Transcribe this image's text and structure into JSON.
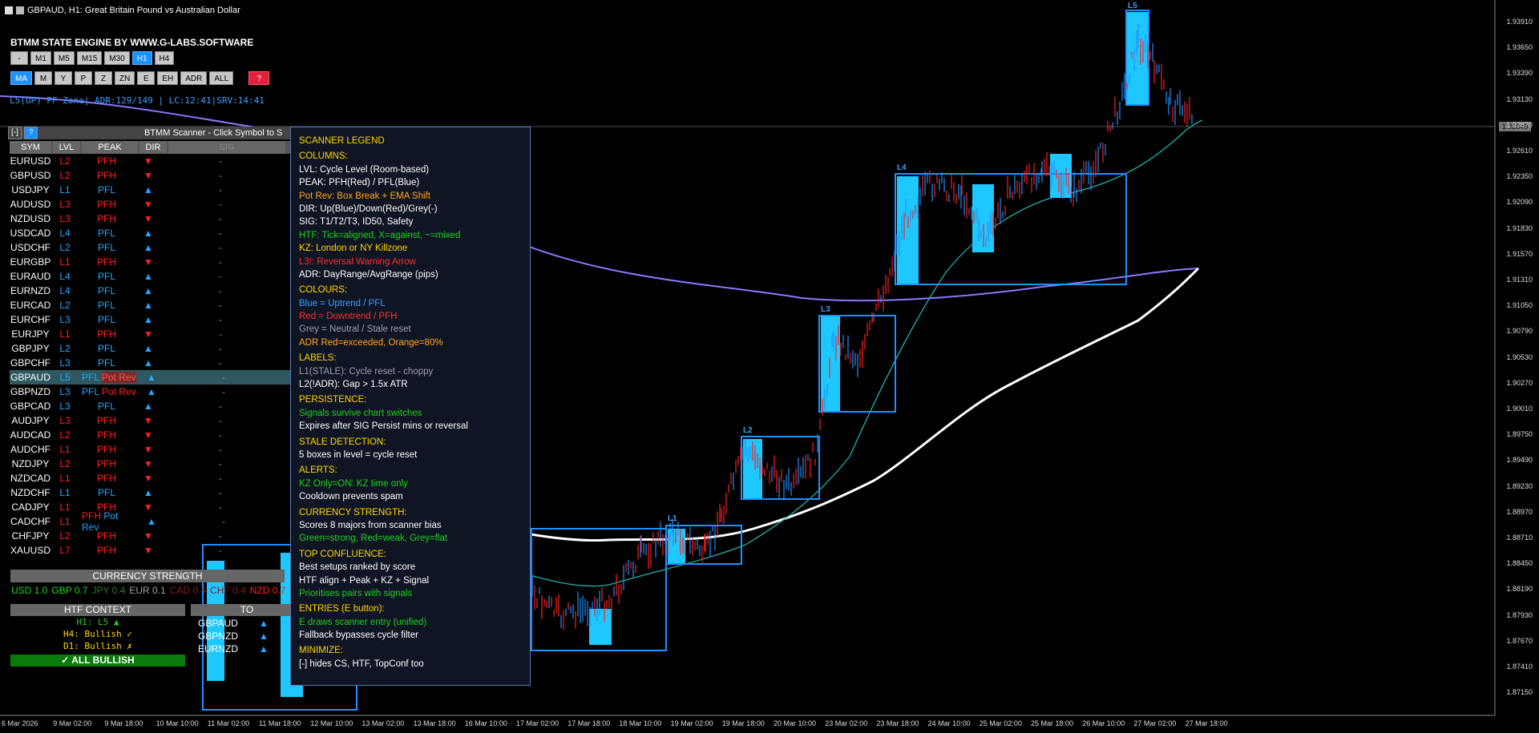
{
  "window": {
    "title": "GBPAUD, H1:  Great Britain Pound vs Australian Dollar"
  },
  "brand": "BTMM STATE ENGINE BY WWW.G-LABS.SOFTWARE",
  "tf_row1": [
    "-",
    "M1",
    "M5",
    "M15",
    "M30",
    "H1",
    "H4"
  ],
  "tf_row1_active": "H1",
  "tf_row2": [
    "MA",
    "M",
    "Y",
    "P",
    "Z",
    "ZN",
    "E",
    "EH",
    "ADR",
    "ALL",
    "?"
  ],
  "tf_row2_active": "MA",
  "status_line": "L5(UP) PF Zone| ADR:129/149 | LC:12:41|SRV:14:41",
  "scanner": {
    "minimize": "[-]",
    "help": "?",
    "title": "BTMM Scanner - Click Symbol to S",
    "headers": [
      "SYM",
      "LVL",
      "PEAK",
      "DIR",
      "SIG"
    ],
    "rows": [
      {
        "sym": "EURUSD",
        "lvl": "L2",
        "lvlc": "red",
        "peak": "PFH",
        "peakc": "red",
        "dir": "▼",
        "dirc": "red",
        "sig": "-"
      },
      {
        "sym": "GBPUSD",
        "lvl": "L2",
        "lvlc": "red",
        "peak": "PFH",
        "peakc": "red",
        "dir": "▼",
        "dirc": "red",
        "sig": "-"
      },
      {
        "sym": "USDJPY",
        "lvl": "L1",
        "lvlc": "blue",
        "peak": "PFL",
        "peakc": "blue",
        "dir": "▲",
        "dirc": "blue",
        "sig": "-"
      },
      {
        "sym": "AUDUSD",
        "lvl": "L3",
        "lvlc": "red",
        "peak": "PFH",
        "peakc": "red",
        "dir": "▼",
        "dirc": "red",
        "sig": "-"
      },
      {
        "sym": "NZDUSD",
        "lvl": "L3",
        "lvlc": "red",
        "peak": "PFH",
        "peakc": "red",
        "dir": "▼",
        "dirc": "red",
        "sig": "-"
      },
      {
        "sym": "USDCAD",
        "lvl": "L4",
        "lvlc": "blue",
        "peak": "PFL",
        "peakc": "blue",
        "dir": "▲",
        "dirc": "blue",
        "sig": "-"
      },
      {
        "sym": "USDCHF",
        "lvl": "L2",
        "lvlc": "blue",
        "peak": "PFL",
        "peakc": "blue",
        "dir": "▲",
        "dirc": "blue",
        "sig": "-"
      },
      {
        "sym": "EURGBP",
        "lvl": "L1",
        "lvlc": "red",
        "peak": "PFH",
        "peakc": "red",
        "dir": "▼",
        "dirc": "red",
        "sig": "-"
      },
      {
        "sym": "EURAUD",
        "lvl": "L4",
        "lvlc": "blue",
        "peak": "PFL",
        "peakc": "blue",
        "dir": "▲",
        "dirc": "blue",
        "sig": "-"
      },
      {
        "sym": "EURNZD",
        "lvl": "L4",
        "lvlc": "blue",
        "peak": "PFL",
        "peakc": "blue",
        "dir": "▲",
        "dirc": "blue",
        "sig": "-"
      },
      {
        "sym": "EURCAD",
        "lvl": "L2",
        "lvlc": "blue",
        "peak": "PFL",
        "peakc": "blue",
        "dir": "▲",
        "dirc": "blue",
        "sig": "-"
      },
      {
        "sym": "EURCHF",
        "lvl": "L3",
        "lvlc": "blue",
        "peak": "PFL",
        "peakc": "blue",
        "dir": "▲",
        "dirc": "blue",
        "sig": "-"
      },
      {
        "sym": "EURJPY",
        "lvl": "L1",
        "lvlc": "red",
        "peak": "PFH",
        "peakc": "red",
        "dir": "▼",
        "dirc": "red",
        "sig": "-"
      },
      {
        "sym": "GBPJPY",
        "lvl": "L2",
        "lvlc": "blue",
        "peak": "PFL",
        "peakc": "blue",
        "dir": "▲",
        "dirc": "blue",
        "sig": "-"
      },
      {
        "sym": "GBPCHF",
        "lvl": "L3",
        "lvlc": "blue",
        "peak": "PFL",
        "peakc": "blue",
        "dir": "▲",
        "dirc": "blue",
        "sig": "-"
      },
      {
        "sym": "GBPAUD",
        "lvl": "L5",
        "lvlc": "blue",
        "peak": "PFL Pot Rev",
        "peakc": "blue",
        "dir": "▲",
        "dirc": "blue",
        "sig": "-",
        "selected": true
      },
      {
        "sym": "GBPNZD",
        "lvl": "L3",
        "lvlc": "blue",
        "peak": "PFL Pot Rev",
        "peakc": "blue",
        "dir": "▲",
        "dirc": "blue",
        "sig": "-"
      },
      {
        "sym": "GBPCAD",
        "lvl": "L3",
        "lvlc": "blue",
        "peak": "PFL",
        "peakc": "blue",
        "dir": "▲",
        "dirc": "blue",
        "sig": "-"
      },
      {
        "sym": "AUDJPY",
        "lvl": "L3",
        "lvlc": "red",
        "peak": "PFH",
        "peakc": "red",
        "dir": "▼",
        "dirc": "red",
        "sig": "-"
      },
      {
        "sym": "AUDCAD",
        "lvl": "L2",
        "lvlc": "red",
        "peak": "PFH",
        "peakc": "red",
        "dir": "▼",
        "dirc": "red",
        "sig": "-"
      },
      {
        "sym": "AUDCHF",
        "lvl": "L1",
        "lvlc": "red",
        "peak": "PFH",
        "peakc": "red",
        "dir": "▼",
        "dirc": "red",
        "sig": "-"
      },
      {
        "sym": "NZDJPY",
        "lvl": "L2",
        "lvlc": "red",
        "peak": "PFH",
        "peakc": "red",
        "dir": "▼",
        "dirc": "red",
        "sig": "-"
      },
      {
        "sym": "NZDCAD",
        "lvl": "L1",
        "lvlc": "red",
        "peak": "PFH",
        "peakc": "red",
        "dir": "▼",
        "dirc": "red",
        "sig": "-"
      },
      {
        "sym": "NZDCHF",
        "lvl": "L1",
        "lvlc": "blue",
        "peak": "PFL",
        "peakc": "blue",
        "dir": "▲",
        "dirc": "blue",
        "sig": "-"
      },
      {
        "sym": "CADJPY",
        "lvl": "L1",
        "lvlc": "red",
        "peak": "PFH",
        "peakc": "red",
        "dir": "▼",
        "dirc": "red",
        "sig": "-"
      },
      {
        "sym": "CADCHF",
        "lvl": "L1",
        "lvlc": "red",
        "peak": "PFH Pot Rev",
        "peakc": "red",
        "dir": "▲",
        "dirc": "blue",
        "sig": "-"
      },
      {
        "sym": "CHFJPY",
        "lvl": "L2",
        "lvlc": "red",
        "peak": "PFH",
        "peakc": "red",
        "dir": "▼",
        "dirc": "red",
        "sig": "-"
      },
      {
        "sym": "XAUUSD",
        "lvl": "L7",
        "lvlc": "red",
        "peak": "PFH",
        "peakc": "red",
        "dir": "▼",
        "dirc": "red",
        "sig": "-"
      }
    ]
  },
  "currency_strength": {
    "title": "CURRENCY STRENGTH",
    "items": [
      {
        "t": "USD 1.0",
        "c": "#20d020"
      },
      {
        "t": "GBP 0.7",
        "c": "#20d020"
      },
      {
        "t": "JPY 0.4",
        "c": "#2a7a2a"
      },
      {
        "t": "EUR 0.1",
        "c": "#9aa0a8"
      },
      {
        "t": "CAD 0.4",
        "c": "#8a1a1a"
      },
      {
        "t": "CHF 0.4",
        "c": "#8a1a1a"
      },
      {
        "t": "NZD 0.7",
        "c": "#ff2020"
      }
    ]
  },
  "htf": {
    "title": "HTF CONTEXT",
    "lines": [
      "H1: L5 ▲",
      "H4: Bullish ✓",
      "D1: Bullish ✗"
    ],
    "verdict": "✓ ALL BULLISH"
  },
  "top_conf": {
    "title": "TO",
    "rows": [
      {
        "sym": "GBPAUD",
        "dir": "▲"
      },
      {
        "sym": "GBPNZD",
        "dir": "▲"
      },
      {
        "sym": "EURNZD",
        "dir": "▲"
      }
    ]
  },
  "legend": [
    {
      "t": "SCANNER LEGEND",
      "c": "yel"
    },
    {
      "t": "COLUMNS:",
      "c": "yel",
      "gap": true
    },
    {
      "t": "LVL: Cycle Level (Room-based)",
      "c": "wht"
    },
    {
      "t": "PEAK: PFH(Red) / PFL(Blue)",
      "c": "wht"
    },
    {
      "t": "Pot Rev: Box Break + EMA Shift",
      "c": "org"
    },
    {
      "t": "DIR: Up(Blue)/Down(Red)/Grey(-)",
      "c": "wht"
    },
    {
      "t": "SIG: T1/T2/T3, ID50, Safety",
      "c": "wht"
    },
    {
      "t": "HTF: Tick=aligned, X=against, ~=mixed",
      "c": "lgrn"
    },
    {
      "t": "KZ: London or NY Killzone",
      "c": "yel"
    },
    {
      "t": "L3!: Reversal Warning Arrow",
      "c": "lr"
    },
    {
      "t": "ADR: DayRange/AvgRange (pips)",
      "c": "wht"
    },
    {
      "t": "COLOURS:",
      "c": "yel",
      "gap": true
    },
    {
      "t": "Blue = Uptrend / PFL",
      "c": "lb"
    },
    {
      "t": "Red = Downtrend / PFH",
      "c": "lr"
    },
    {
      "t": "Grey = Neutral / Stale reset",
      "c": "lgry"
    },
    {
      "t": "ADR Red=exceeded, Orange=80%",
      "c": "org"
    },
    {
      "t": "LABELS:",
      "c": "yel",
      "gap": true
    },
    {
      "t": "L1(STALE): Cycle reset - choppy",
      "c": "lgry"
    },
    {
      "t": "L2(!ADR): Gap > 1.5x ATR",
      "c": "wht"
    },
    {
      "t": "PERSISTENCE:",
      "c": "yel",
      "gap": true
    },
    {
      "t": "Signals survive chart switches",
      "c": "lgrn"
    },
    {
      "t": "Expires after SIG Persist mins or reversal",
      "c": "wht"
    },
    {
      "t": "STALE DETECTION:",
      "c": "yel",
      "gap": true
    },
    {
      "t": "5 boxes in level = cycle reset",
      "c": "wht"
    },
    {
      "t": "ALERTS:",
      "c": "yel",
      "gap": true
    },
    {
      "t": "KZ Only=ON: KZ time only",
      "c": "lgrn"
    },
    {
      "t": "Cooldown prevents spam",
      "c": "wht"
    },
    {
      "t": "CURRENCY STRENGTH:",
      "c": "yel",
      "gap": true
    },
    {
      "t": "Scores 8 majors from scanner bias",
      "c": "wht"
    },
    {
      "t": "Green=strong, Red=weak, Grey=flat",
      "c": "lgrn"
    },
    {
      "t": "TOP CONFLUENCE:",
      "c": "yel",
      "gap": true
    },
    {
      "t": "Best setups ranked by score",
      "c": "wht"
    },
    {
      "t": "HTF align + Peak + KZ + Signal",
      "c": "wht"
    },
    {
      "t": "Prioritises pairs with signals",
      "c": "lgrn"
    },
    {
      "t": "ENTRIES (E button):",
      "c": "yel",
      "gap": true
    },
    {
      "t": "E draws scanner entry (unified)",
      "c": "lgrn"
    },
    {
      "t": "Fallback bypasses cycle filter",
      "c": "wht"
    },
    {
      "t": "MINIMIZE:",
      "c": "yel",
      "gap": true
    },
    {
      "t": "[-] hides CS, HTF, TopConf too",
      "c": "wht"
    }
  ],
  "price_axis": [
    "1.93910",
    "1.93650",
    "1.93390",
    "1.93130",
    "1.92870",
    "1.92610",
    "1.92350",
    "1.92090",
    "1.91830",
    "1.91570",
    "1.91310",
    "1.91050",
    "1.90790",
    "1.90530",
    "1.90270",
    "1.90010",
    "1.89750",
    "1.89490",
    "1.89230",
    "1.88970",
    "1.88710",
    "1.88450",
    "1.88190",
    "1.87930",
    "1.87670",
    "1.87410",
    "1.87150"
  ],
  "current_price": "1.92849",
  "time_axis": [
    "6 Mar 2026",
    "9 Mar 02:00",
    "9 Mar 18:00",
    "10 Mar 10:00",
    "11 Mar 02:00",
    "11 Mar 18:00",
    "12 Mar 10:00",
    "13 Mar 02:00",
    "13 Mar 18:00",
    "16 Mar 10:00",
    "17 Mar 02:00",
    "17 Mar 18:00",
    "18 Mar 10:00",
    "19 Mar 02:00",
    "19 Mar 18:00",
    "20 Mar 10:00",
    "23 Mar 02:00",
    "23 Mar 18:00",
    "24 Mar 10:00",
    "25 Mar 02:00",
    "25 Mar 18:00",
    "26 Mar 10:00",
    "27 Mar 02:00",
    "27 Mar 18:00"
  ],
  "level_labels": [
    "L1",
    "L2",
    "L3",
    "L4",
    "L5"
  ],
  "colors": {
    "box": "#1e90ff",
    "fill": "#1ec8ff",
    "ema_white": "#ffffff",
    "ema_purple": "#8a7aff",
    "ema_cyan": "#20b0b0",
    "bull": "#1e90ff",
    "bear": "#ff2020"
  }
}
